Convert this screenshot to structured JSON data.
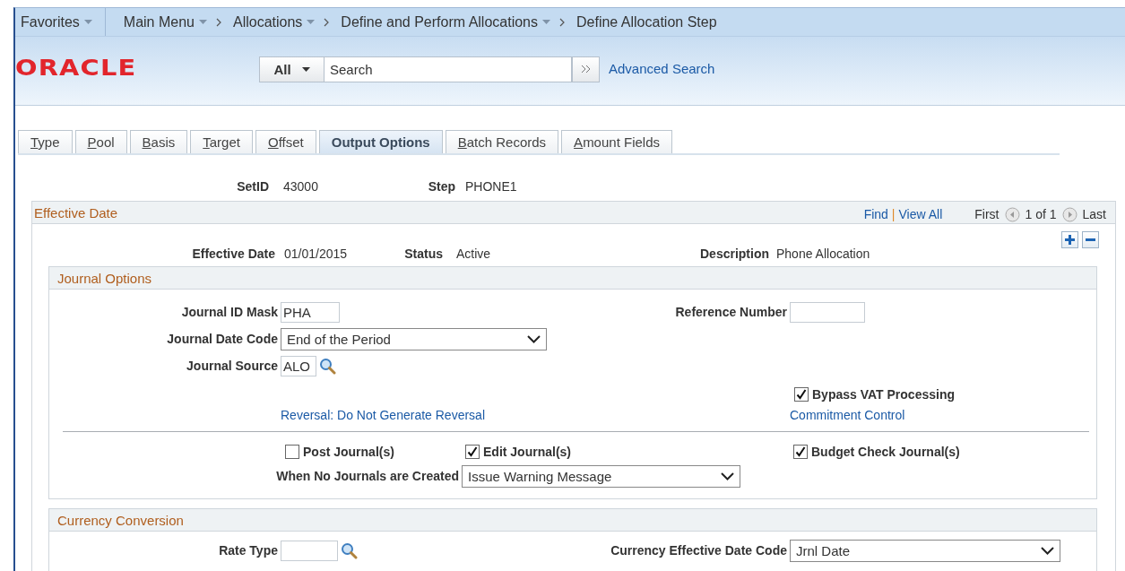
{
  "nav": {
    "favorites": "Favorites",
    "breadcrumbs": [
      {
        "label": "Main Menu",
        "dropdown": true
      },
      {
        "label": "Allocations",
        "dropdown": true
      },
      {
        "label": "Define and Perform Allocations",
        "dropdown": true
      },
      {
        "label": "Define Allocation Step",
        "dropdown": false
      }
    ]
  },
  "header": {
    "logo": "ORACLE",
    "search_scope": "All",
    "search_placeholder": "Search",
    "advanced_search": "Advanced Search"
  },
  "tabs": [
    {
      "label": "Type",
      "selected": false
    },
    {
      "label": "Pool",
      "selected": false
    },
    {
      "label": "Basis",
      "selected": false
    },
    {
      "label": "Target",
      "selected": false
    },
    {
      "label": "Offset",
      "selected": false
    },
    {
      "label": "Output Options",
      "selected": true
    },
    {
      "label": "Batch Records",
      "selected": false
    },
    {
      "label": "Amount Fields",
      "selected": false
    }
  ],
  "key_fields": [
    {
      "label": "SetID",
      "value": "43000"
    },
    {
      "label": "Step",
      "value": "PHONE1"
    }
  ],
  "effective_date": {
    "title": "Effective Date",
    "links": [
      "Find",
      "View All"
    ],
    "link_separator": "|",
    "pager": {
      "first": "First",
      "position": "1 of 1",
      "last": "Last"
    },
    "fields": [
      {
        "label": "Effective Date",
        "value": "01/01/2015"
      },
      {
        "label": "Status",
        "value": "Active"
      },
      {
        "label": "Description",
        "value": "Phone Allocation"
      }
    ]
  },
  "journal_options": {
    "title": "Journal Options",
    "journal_id_mask": {
      "label": "Journal ID Mask",
      "value": "PHA"
    },
    "reference_number": {
      "label": "Reference Number"
    },
    "journal_date_code": {
      "label": "Journal Date Code",
      "value": "End of the Period"
    },
    "journal_source": {
      "label": "Journal Source",
      "value": "ALO"
    },
    "bypass_vat": {
      "label": "Bypass VAT Processing",
      "checked": true
    },
    "reversal_link": "Reversal: Do Not Generate Reversal",
    "commitment_control_link": "Commitment Control",
    "post_journals": {
      "label": "Post Journal(s)",
      "checked": false
    },
    "edit_journals": {
      "label": "Edit Journal(s)",
      "checked": true
    },
    "budget_check": {
      "label": "Budget Check Journal(s)",
      "checked": true
    },
    "when_no_journals": {
      "label": "When No Journals are Created",
      "value": "Issue Warning Message"
    }
  },
  "currency_conversion": {
    "title": "Currency Conversion",
    "rate_type": {
      "label": "Rate Type"
    },
    "currency_effective_date_code": {
      "label": "Currency Effective Date Code",
      "value": "Jrnl Date"
    }
  }
}
